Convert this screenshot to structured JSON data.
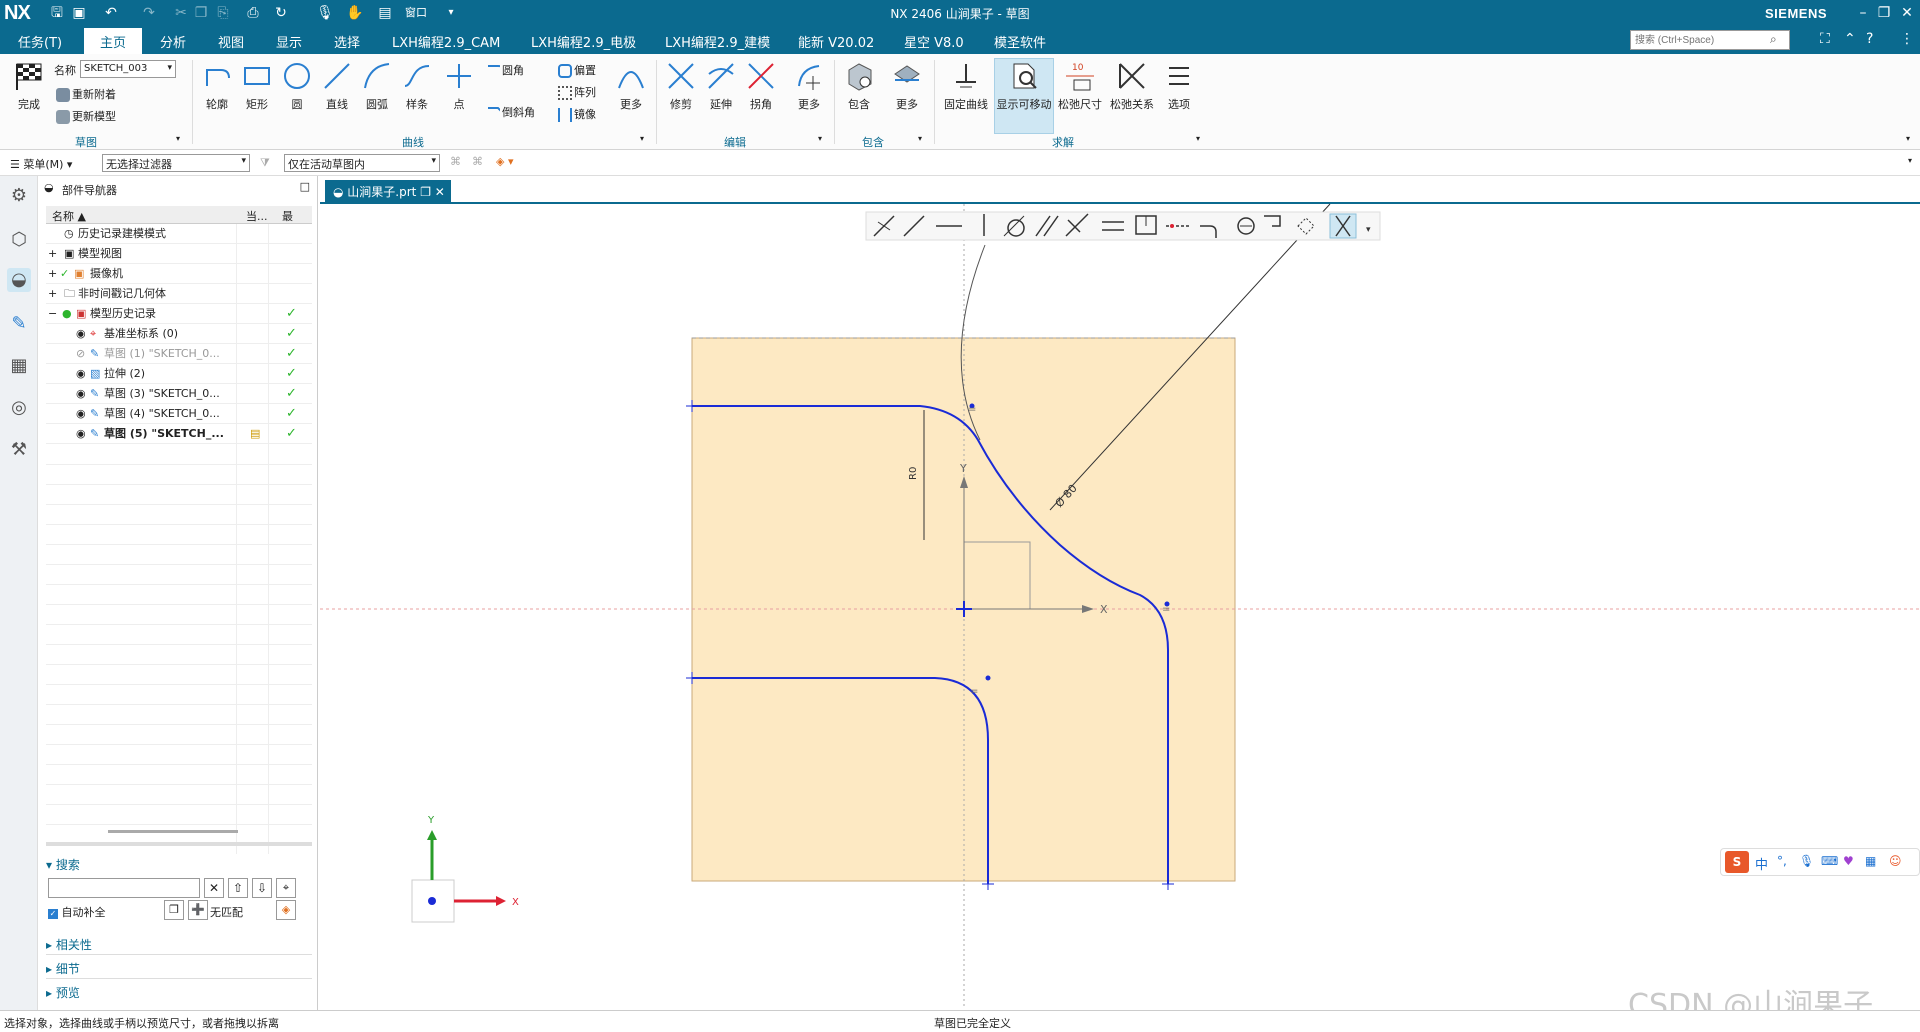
{
  "titlebar": {
    "logo": "NX",
    "title": "NX 2406 山涧果子 - 草图",
    "brand": "SIEMENS",
    "window_menu": "窗口"
  },
  "menu": {
    "tabs": [
      "任务(T)",
      "主页",
      "分析",
      "视图",
      "显示",
      "选择",
      "LXH编程2.9_CAM",
      "LXH编程2.9_电极",
      "LXH编程2.9_建模",
      "能新 V20.02",
      "星空 V8.0",
      "模圣软件"
    ],
    "active": "主页",
    "search_placeholder": "搜索 (Ctrl+Space)"
  },
  "ribbon": {
    "finish_label": "完成",
    "name_label": "名称",
    "name_value": "SKETCH_003",
    "reattach_label": "重新附着",
    "update_model_label": "更新模型",
    "group_sketch": "草图",
    "curve_tools": [
      "轮廓",
      "矩形",
      "圆",
      "直线",
      "圆弧",
      "样条",
      "点"
    ],
    "fillet_label": "圆角",
    "chamfer_label": "倒斜角",
    "offset_label": "偏置",
    "array_label": "阵列",
    "mirror_label": "镜像",
    "more_label": "更多",
    "group_curve": "曲线",
    "edit_tools": [
      "修剪",
      "延伸",
      "拐角"
    ],
    "group_edit": "编辑",
    "include_label": "包含",
    "group_include": "包含",
    "solve_tools": [
      "固定曲线",
      "显示可移动",
      "松弛尺寸",
      "松弛关系",
      "选项"
    ],
    "group_solve": "求解"
  },
  "toolbar2": {
    "menu_label": "菜单(M)",
    "filter_value": "无选择过滤器",
    "scope_value": "仅在活动草图内"
  },
  "navigator": {
    "title": "部件导航器",
    "col_name": "名称",
    "col_current": "当...",
    "col_latest": "最",
    "rows": [
      {
        "label": "历史记录建模模式",
        "check": ""
      },
      {
        "label": "模型视图",
        "check": ""
      },
      {
        "label": "摄像机",
        "check": ""
      },
      {
        "label": "非时间戳记几何体",
        "check": ""
      },
      {
        "label": "模型历史记录",
        "check": "✓"
      },
      {
        "label": "基准坐标系 (0)",
        "check": "✓"
      },
      {
        "label": "草图 (1) \"SKETCH_0...",
        "check": "✓"
      },
      {
        "label": "拉伸 (2)",
        "check": "✓"
      },
      {
        "label": "草图 (3) \"SKETCH_0...",
        "check": "✓"
      },
      {
        "label": "草图 (4) \"SKETCH_0...",
        "check": "✓"
      },
      {
        "label": "草图 (5) \"SKETCH_...",
        "check": "✓"
      }
    ],
    "search_label": "搜索",
    "auto_complete_label": "自动补全",
    "no_match_label": "无匹配",
    "related_label": "相关性",
    "details_label": "细节",
    "preview_label": "预览"
  },
  "document_tab": "山涧果子.prt",
  "sketch": {
    "dim_radius": "R0",
    "dim_diameter": "Ø 80",
    "axis_x": "X",
    "axis_y": "Y",
    "triad_x": "X",
    "triad_y": "Y"
  },
  "status": {
    "left": "选择对象，选择曲线或手柄以预览尺寸，或者拖拽以拆离",
    "center": "草图已完全定义"
  },
  "ime": {
    "lang": "中"
  },
  "watermark": "CSDN @山涧果子",
  "colors": {
    "accent": "#0b6a8f",
    "sketch_plane": "#fde9c3",
    "curve": "#1a2bd6",
    "check": "#2db52d"
  }
}
